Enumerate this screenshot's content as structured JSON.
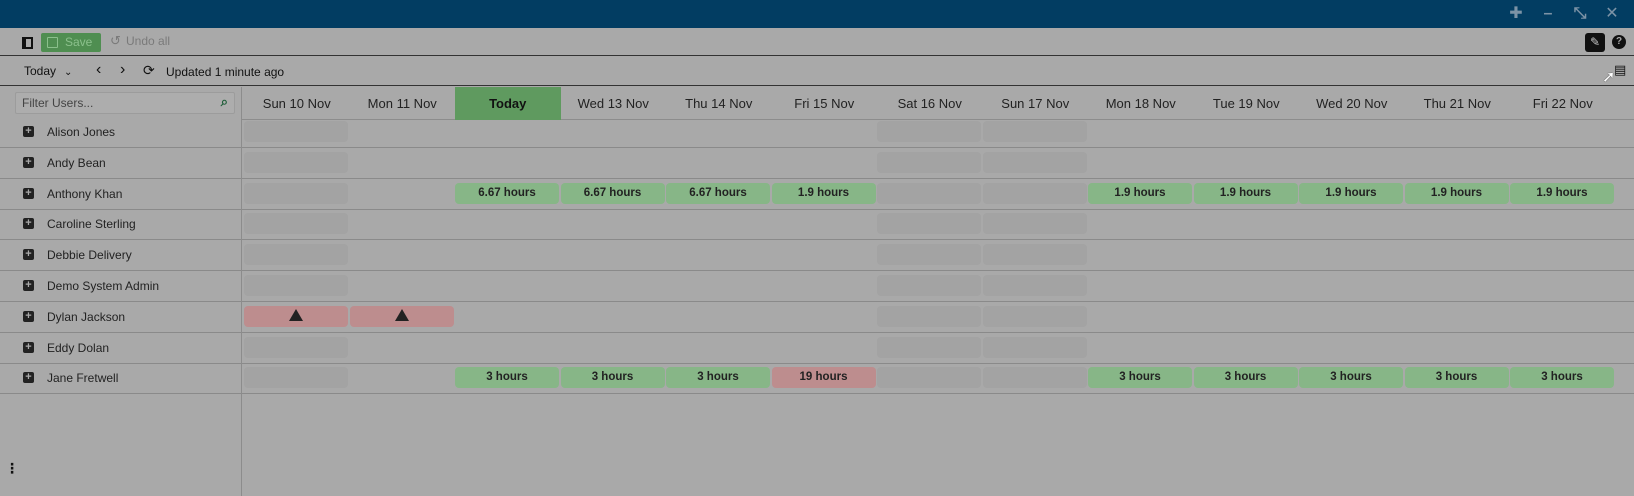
{
  "window": {
    "pin_icon": "pin-icon",
    "minimize_icon": "minimize-icon",
    "restore_icon": "restore-icon",
    "close_icon": "close-icon"
  },
  "toolbar": {
    "save_label": "Save",
    "undo_label": "Undo all"
  },
  "nav": {
    "period": "Today",
    "updated": "Updated 1 minute ago"
  },
  "filter": {
    "placeholder": "Filter Users..."
  },
  "days": [
    "Sun 10 Nov",
    "Mon 11 Nov",
    "Today",
    "Wed 13 Nov",
    "Thu 14 Nov",
    "Fri 15 Nov",
    "Sat 16 Nov",
    "Sun 17 Nov",
    "Mon 18 Nov",
    "Tue 19 Nov",
    "Wed 20 Nov",
    "Thu 21 Nov",
    "Fri 22 Nov"
  ],
  "users": [
    {
      "name": "Alison Jones",
      "cells": [
        "blank",
        "",
        "",
        "",
        "",
        "",
        "blank",
        "blank",
        "",
        "",
        "",
        "",
        ""
      ]
    },
    {
      "name": "Andy Bean",
      "cells": [
        "blank",
        "",
        "",
        "",
        "",
        "",
        "blank",
        "blank",
        "",
        "",
        "",
        "",
        ""
      ]
    },
    {
      "name": "Anthony Khan",
      "cells": [
        "blank",
        "",
        "6.67 hours",
        "6.67 hours",
        "6.67 hours",
        "1.9 hours",
        "blank",
        "blank",
        "1.9 hours",
        "1.9 hours",
        "1.9 hours",
        "1.9 hours",
        "1.9 hours"
      ]
    },
    {
      "name": "Caroline Sterling",
      "cells": [
        "blank",
        "",
        "",
        "",
        "",
        "",
        "blank",
        "blank",
        "",
        "",
        "",
        "",
        ""
      ]
    },
    {
      "name": "Debbie Delivery",
      "cells": [
        "blank",
        "",
        "",
        "",
        "",
        "",
        "blank",
        "blank",
        "",
        "",
        "",
        "",
        ""
      ]
    },
    {
      "name": "Demo System Admin",
      "cells": [
        "blank",
        "",
        "",
        "",
        "",
        "",
        "blank",
        "blank",
        "",
        "",
        "",
        "",
        ""
      ]
    },
    {
      "name": "Dylan Jackson",
      "cells": [
        "warning",
        "warning",
        "",
        "",
        "",
        "",
        "blank",
        "blank",
        "",
        "",
        "",
        "",
        ""
      ]
    },
    {
      "name": "Eddy Dolan",
      "cells": [
        "blank",
        "",
        "",
        "",
        "",
        "",
        "blank",
        "blank",
        "",
        "",
        "",
        "",
        ""
      ]
    },
    {
      "name": "Jane Fretwell",
      "cells": [
        "blank",
        "",
        "3 hours",
        "3 hours",
        "3 hours",
        "19 hours",
        "blank",
        "blank",
        "3 hours",
        "3 hours",
        "3 hours",
        "3 hours",
        "3 hours"
      ]
    }
  ],
  "over_threshold": [
    "19 hours"
  ],
  "colors": {
    "titlebar": "#023d62",
    "ok": "#87b687",
    "alert": "#bd8d8e",
    "today": "#5f9a5f"
  }
}
